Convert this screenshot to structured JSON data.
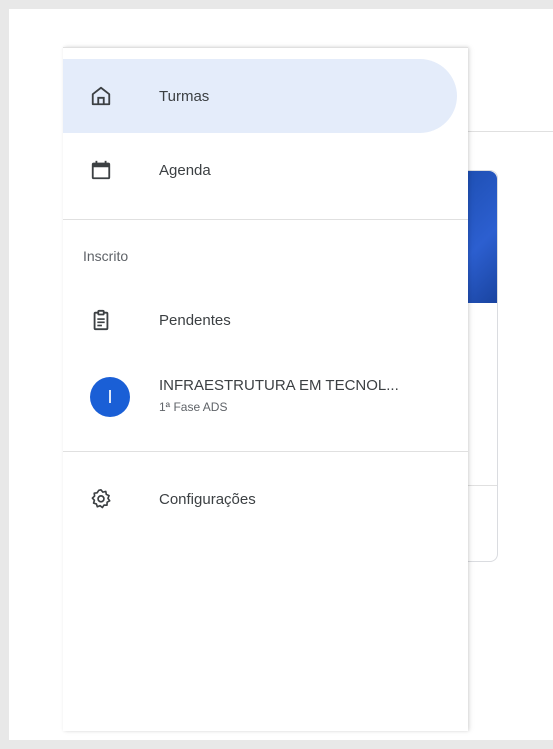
{
  "drawer": {
    "items_top": [
      {
        "label": "Turmas",
        "icon": "home-icon",
        "active": true
      },
      {
        "label": "Agenda",
        "icon": "calendar-icon",
        "active": false
      }
    ],
    "section_label": "Inscrito",
    "enrolled": {
      "pending_label": "Pendentes",
      "pending_icon": "assignment-icon",
      "course": {
        "avatar_letter": "I",
        "title": "INFRAESTRUTURA EM TECNOL...",
        "subtitle": "1ª Fase ADS",
        "avatar_color": "#1a5fd6"
      }
    },
    "settings_label": "Configurações",
    "settings_icon": "gear-icon",
    "active_bg": "#e4ecfa"
  }
}
